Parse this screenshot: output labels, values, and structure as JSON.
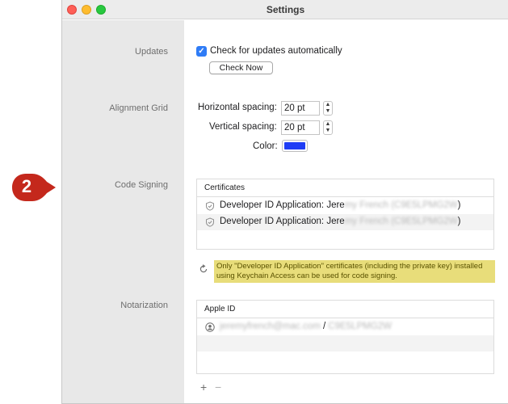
{
  "callout": {
    "number": "2",
    "color": "#c4281c"
  },
  "window": {
    "title": "Settings"
  },
  "sections": {
    "updates": {
      "label": "Updates",
      "auto_check_label": "Check for updates automatically",
      "auto_check_checked": true,
      "check_now_label": "Check Now"
    },
    "alignment_grid": {
      "label": "Alignment Grid",
      "horizontal_label": "Horizontal spacing:",
      "horizontal_value": "20 pt",
      "vertical_label": "Vertical spacing:",
      "vertical_value": "20 pt",
      "color_label": "Color:",
      "color_value": "#1f3df5"
    },
    "code_signing": {
      "label": "Code Signing",
      "table_header": "Certificates",
      "certificates": [
        {
          "prefix": "Developer ID Application: Jere",
          "redacted": "my French (C9E5LPMG2W",
          "suffix": ")"
        },
        {
          "prefix": "Developer ID Application: Jere",
          "redacted": "my French (C9E5LPMG2W",
          "suffix": ")"
        }
      ],
      "notice": "Only \"Developer ID Application\" certificates (including the private key) installed using Keychain Access can be used for code signing."
    },
    "notarization": {
      "label": "Notarization",
      "table_header": "Apple ID",
      "account_email": "jeremyfrench@mac.com",
      "separator": "/",
      "account_team": "C9E5LPMG2W",
      "add_label": "+",
      "remove_label": "−"
    }
  },
  "colors": {
    "accent": "#2f7cf6",
    "notice_bg": "#e8dd7a",
    "sidebar_bg": "#e8e8e8"
  }
}
